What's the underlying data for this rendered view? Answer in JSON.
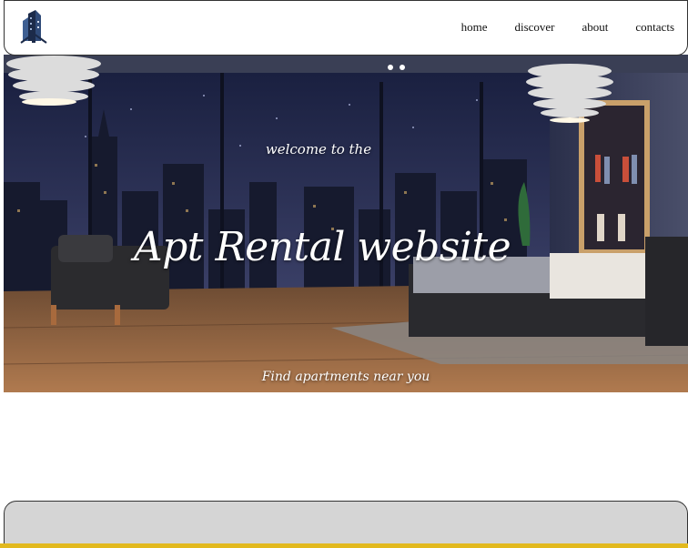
{
  "nav": {
    "logo_icon": "building-logo-icon",
    "links": [
      "home",
      "discover",
      "about",
      "contacts"
    ]
  },
  "hero": {
    "welcome": "welcome to the",
    "title": "Apt Rental website",
    "subtitle": "Find apartments near you"
  },
  "section": {
    "heading": ""
  },
  "colors": {
    "card_background": "#d5d5d5",
    "bottom_strip": "#e2b91e"
  }
}
